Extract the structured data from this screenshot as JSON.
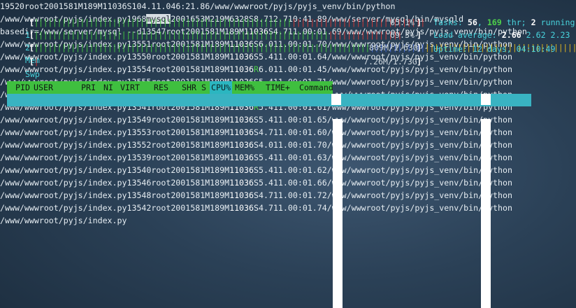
{
  "meters": {
    "cpu1": {
      "label": "1",
      "value": "65.1%",
      "level": 0.651
    },
    "cpu2": {
      "label": "2",
      "value": "69.3%",
      "level": 0.693
    },
    "mem": {
      "label": "Mem",
      "value": "809M/1.63G",
      "level": 0.496
    },
    "swp": {
      "label": "Swp",
      "value": "7.26M/1.73G",
      "level": 0.004
    }
  },
  "summary": {
    "tasks_label": "Tasks: ",
    "tasks": "56",
    "thr_sep": ", ",
    "thr": "169",
    "thr_label": " thr; ",
    "running": "2",
    "running_label": " running",
    "load_label": "Load average: ",
    "load1": "2.66",
    "load5": "2.62",
    "load15": "2.23",
    "uptime_label": "Uptime: ",
    "uptime": "12 days, 04:10:49"
  },
  "columns": {
    "pid": "PID",
    "user": "USER",
    "pri": "PRI",
    "ni": "NI",
    "virt": "VIRT",
    "res": "RES",
    "shr": "SHR",
    "s": "S",
    "cpu": "CPU%",
    "mem": "MEM%",
    "time": "TIME+",
    "cmd": "Command"
  },
  "processes": [
    {
      "pid": "19520",
      "user": "root",
      "pri": "20",
      "ni": "0",
      "virt": "1581M",
      "res": "189M",
      "shr": "11036",
      "s": "S",
      "cpu": "104.",
      "mem": "11.0",
      "time": "46:21.86",
      "cmd": "/www/wwwroot/pyjs/pyjs_venv/bin/python /www/wwwroot/pyjs/index.py"
    },
    {
      "pid": "1968",
      "user": "mysql",
      "pri": "20",
      "ni": "0",
      "virt": "1653M",
      "res": "219M",
      "shr": "6328",
      "s": "S",
      "cpu": "8.7",
      "mem": "12.7",
      "time": "10:41.89",
      "cmd": "/www/server/mysql/bin/mysqld --basedir=/www/server/mysql --d"
    },
    {
      "pid": "13547",
      "user": "root",
      "pri": "20",
      "ni": "0",
      "virt": "1581M",
      "res": "189M",
      "shr": "11036",
      "s": "S",
      "cpu": "4.7",
      "mem": "11.0",
      "time": "0:01.69",
      "cmd": "/www/wwwroot/pyjs/pyjs_venv/bin/python /www/wwwroot/pyjs/index.py"
    },
    {
      "pid": "13551",
      "user": "root",
      "pri": "20",
      "ni": "0",
      "virt": "1581M",
      "res": "189M",
      "shr": "11036",
      "s": "S",
      "cpu": "6.0",
      "mem": "11.0",
      "time": "0:01.70",
      "cmd": "/www/wwwroot/pyjs/pyjs_venv/bin/python /www/wwwroot/pyjs/index.py"
    },
    {
      "pid": "13550",
      "user": "root",
      "pri": "20",
      "ni": "0",
      "virt": "1581M",
      "res": "189M",
      "shr": "11036",
      "s": "S",
      "cpu": "5.4",
      "mem": "11.0",
      "time": "0:01.64",
      "cmd": "/www/wwwroot/pyjs/pyjs_venv/bin/python /www/wwwroot/pyjs/index.py"
    },
    {
      "pid": "13554",
      "user": "root",
      "pri": "20",
      "ni": "0",
      "virt": "1581M",
      "res": "189M",
      "shr": "11036",
      "s": "R",
      "cpu": "6.0",
      "mem": "11.0",
      "time": "0:01.45",
      "cmd": "/www/wwwroot/pyjs/pyjs_venv/bin/python /www/wwwroot/pyjs/index.py"
    },
    {
      "pid": "13555",
      "user": "root",
      "pri": "20",
      "ni": "0",
      "virt": "1581M",
      "res": "189M",
      "shr": "11036",
      "s": "S",
      "cpu": "5.4",
      "mem": "11.0",
      "time": "0:01.71",
      "cmd": "/www/wwwroot/pyjs/pyjs_venv/bin/python /www/wwwroot/pyjs/index.py"
    },
    {
      "pid": "13537",
      "user": "root",
      "pri": "20",
      "ni": "0",
      "virt": "1581M",
      "res": "189M",
      "shr": "11036",
      "s": "S",
      "cpu": "4.7",
      "mem": "11.0",
      "time": "0:01.74",
      "cmd": "/www/wwwroot/pyjs/pyjs_venv/bin/python /www/wwwroot/pyjs/index.py"
    },
    {
      "pid": "13541",
      "user": "root",
      "pri": "20",
      "ni": "0",
      "virt": "1581M",
      "res": "189M",
      "shr": "11036",
      "s": "R",
      "cpu": "5.4",
      "mem": "11.0",
      "time": "0:01.61",
      "cmd": "/www/wwwroot/pyjs/pyjs_venv/bin/python /www/wwwroot/pyjs/index.py"
    },
    {
      "pid": "13549",
      "user": "root",
      "pri": "20",
      "ni": "0",
      "virt": "1581M",
      "res": "189M",
      "shr": "11036",
      "s": "S",
      "cpu": "5.4",
      "mem": "11.0",
      "time": "0:01.65",
      "cmd": "/www/wwwroot/pyjs/pyjs_venv/bin/python /www/wwwroot/pyjs/index.py"
    },
    {
      "pid": "13553",
      "user": "root",
      "pri": "20",
      "ni": "0",
      "virt": "1581M",
      "res": "189M",
      "shr": "11036",
      "s": "S",
      "cpu": "4.7",
      "mem": "11.0",
      "time": "0:01.60",
      "cmd": "/www/wwwroot/pyjs/pyjs_venv/bin/python /www/wwwroot/pyjs/index.py"
    },
    {
      "pid": "13552",
      "user": "root",
      "pri": "20",
      "ni": "0",
      "virt": "1581M",
      "res": "189M",
      "shr": "11036",
      "s": "S",
      "cpu": "4.0",
      "mem": "11.0",
      "time": "0:01.70",
      "cmd": "/www/wwwroot/pyjs/pyjs_venv/bin/python /www/wwwroot/pyjs/index.py"
    },
    {
      "pid": "13539",
      "user": "root",
      "pri": "20",
      "ni": "0",
      "virt": "1581M",
      "res": "189M",
      "shr": "11036",
      "s": "S",
      "cpu": "5.4",
      "mem": "11.0",
      "time": "0:01.63",
      "cmd": "/www/wwwroot/pyjs/pyjs_venv/bin/python /www/wwwroot/pyjs/index.py"
    },
    {
      "pid": "13540",
      "user": "root",
      "pri": "20",
      "ni": "0",
      "virt": "1581M",
      "res": "189M",
      "shr": "11036",
      "s": "S",
      "cpu": "5.4",
      "mem": "11.0",
      "time": "0:01.62",
      "cmd": "/www/wwwroot/pyjs/pyjs_venv/bin/python /www/wwwroot/pyjs/index.py"
    },
    {
      "pid": "13546",
      "user": "root",
      "pri": "20",
      "ni": "0",
      "virt": "1581M",
      "res": "189M",
      "shr": "11036",
      "s": "S",
      "cpu": "5.4",
      "mem": "11.0",
      "time": "0:01.66",
      "cmd": "/www/wwwroot/pyjs/pyjs_venv/bin/python /www/wwwroot/pyjs/index.py"
    },
    {
      "pid": "13548",
      "user": "root",
      "pri": "20",
      "ni": "0",
      "virt": "1581M",
      "res": "189M",
      "shr": "11036",
      "s": "S",
      "cpu": "4.7",
      "mem": "11.0",
      "time": "0:01.72",
      "cmd": "/www/wwwroot/pyjs/pyjs_venv/bin/python /www/wwwroot/pyjs/index.py"
    },
    {
      "pid": "13542",
      "user": "root",
      "pri": "20",
      "ni": "0",
      "virt": "1581M",
      "res": "189M",
      "shr": "11036",
      "s": "S",
      "cpu": "4.7",
      "mem": "11.0",
      "time": "0:01.74",
      "cmd": "/www/wwwroot/pyjs/pyjs_venv/bin/python /www/wwwroot/pyjs/index.py"
    }
  ],
  "colors": {
    "header_bg": "#3fbf3f",
    "selected_row_bg": "#39b3c2",
    "cpu_bar_low": "#40c040",
    "cpu_bar_high": "#d03838",
    "mem_bar_buffers": "#3d62c8",
    "mem_bar_cache": "#d8b020"
  }
}
